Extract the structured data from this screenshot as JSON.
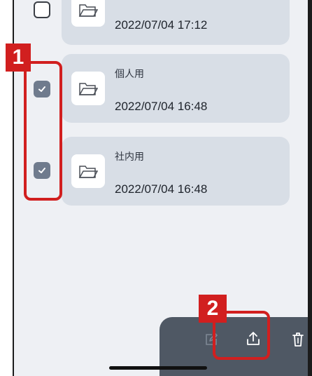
{
  "folders": [
    {
      "name": "",
      "date": "2022/07/04 17:12",
      "checked": false
    },
    {
      "name": "個人用",
      "date": "2022/07/04 16:48",
      "checked": true
    },
    {
      "name": "社内用",
      "date": "2022/07/04 16:48",
      "checked": true
    }
  ],
  "callouts": {
    "first": "1",
    "second": "2"
  },
  "toolbar": {
    "edit_icon": "pencil-square-icon",
    "share_icon": "upload-share-icon",
    "delete_icon": "trash-icon"
  },
  "colors": {
    "accent_red": "#d11f1f",
    "card_bg": "#d8dee6",
    "checkbox_checked": "#6f7b8d",
    "toolbar_bg": "#4f5864"
  }
}
